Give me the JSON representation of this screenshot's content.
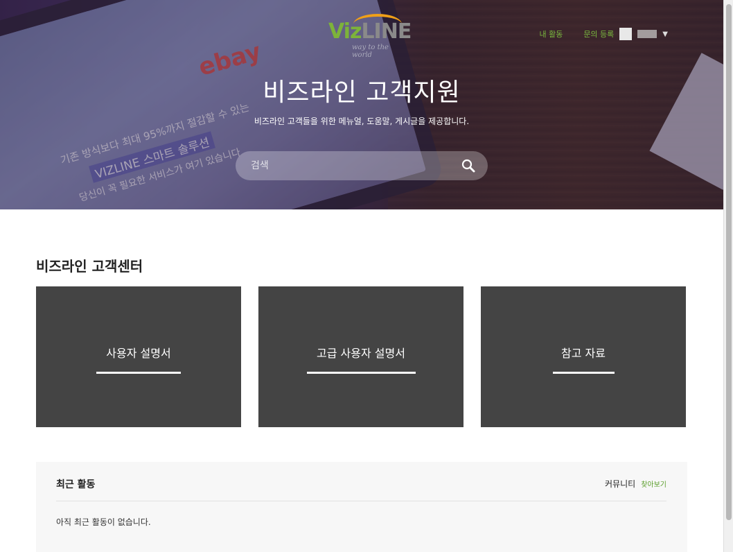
{
  "header": {
    "logo": {
      "main_a": "Viz",
      "main_b": "LINE",
      "tagline": "way to the world"
    },
    "nav": {
      "my_activity": "내 활동",
      "submit_request": "문의 등록"
    },
    "title": "비즈라인 고객지원",
    "subtitle": "비즈라인 고객들을 위한 메뉴얼, 도움말, 게시글을 제공합니다.",
    "search_placeholder": "검색"
  },
  "hero_decor": {
    "brand": "ebay",
    "line1": "기존 방식보다 최대 95%까지 절감할 수 있는",
    "line2": "VIZLINE 스마트 솔루션",
    "line3": "당신이 꼭 필요한 서비스가 여기 있습니다"
  },
  "main": {
    "section_title": "비즈라인 고객센터",
    "cards": [
      {
        "label": "사용자 설명서"
      },
      {
        "label": "고급 사용자 설명서"
      },
      {
        "label": "참고 자료"
      }
    ]
  },
  "activity": {
    "title": "최근 활동",
    "community_label": "커뮤니티",
    "browse_link": "찾아보기",
    "empty_message": "아직 최근 활동이 없습니다."
  },
  "colors": {
    "accent_green": "#79b83e",
    "card_bg": "#444444",
    "logo_orange": "#f0a018"
  }
}
